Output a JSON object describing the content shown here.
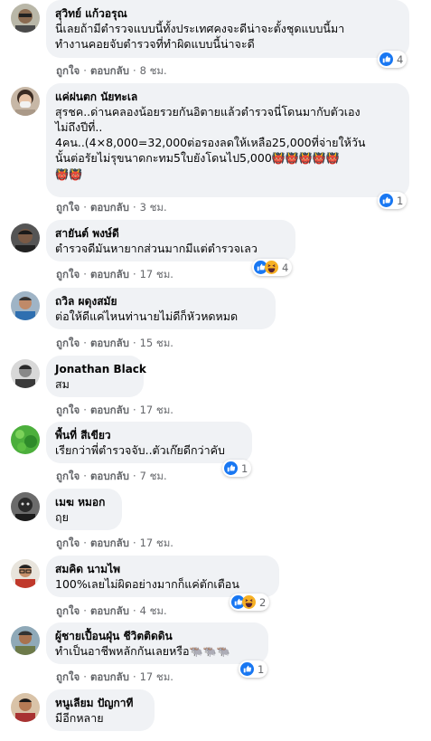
{
  "actions": {
    "like": "ถูกใจ",
    "reply": "ตอบกลับ",
    "sep": "·"
  },
  "colors": {
    "like_blue": "#1877f2",
    "haha_yellow": "#f7b125",
    "bubble": "#f0f2f5",
    "meta_gray": "#65676b"
  },
  "comments": [
    {
      "author": "สุวิทย์ แก้วอรุณ",
      "text": "นี่เลยถ้ามีตำรวจแบบนี้ทั้งประเทศคงจะดีน่าจะตั้งชุดแบบนี้มา\nทำงานคอยจับตำรวจที่ทำผิดแบบนี้น่าจะดี",
      "time": "8 ชม.",
      "reactions": [
        "like-icon"
      ],
      "reaction_count": "4",
      "avatar": "man-sunglasses-avatar"
    },
    {
      "author": "แค่ฝนตก นัยทะเล",
      "text": "สุรชค..ด่านคลองน้อยรวยกันอิตายแล้วตำรวจนี่โดนมากับตัวเอง\nไม่ถึงปีที่..\n4คน..(4×8,000=32,000ต่อรองลดให้เหลือ25,000ที่จ่ายให้วัน\nนั้นต่อรัยไม่รุขนาดกะทม5ใบยังโดนไป5,000",
      "emoji": "👹👹👹👹👹\n👹👹",
      "time": "3 ชม.",
      "reactions": [
        "like-icon"
      ],
      "reaction_count": "1",
      "avatar": "woman-mask-avatar"
    },
    {
      "author": "สายันต์ พงษ์ดี",
      "text": "ตำรวจดีมันหายากส่วนมากมีแต่ตำรวจเลว",
      "time": "17 ชม.",
      "reactions": [
        "like-icon",
        "haha-icon"
      ],
      "reaction_count": "4",
      "avatar": "man-dark-avatar"
    },
    {
      "author": "ถวิล ผดุงสมัย",
      "text": "ต่อให้ดีแค่ไหนท่านายไม่ดีก็หัวหดหมด",
      "time": "15 ชม.",
      "reactions": [],
      "reaction_count": "",
      "avatar": "man-blue-shirt-avatar"
    },
    {
      "author": "Jonathan Black",
      "text": "สม",
      "time": "17 ชม.",
      "reactions": [],
      "reaction_count": "",
      "avatar": "man-bw-avatar"
    },
    {
      "author": "พื้นที่ สีเขียว",
      "text": "เรียกว่าพี่ตำรวจจับ..ตัวเก๊ยดีกว่าคับ",
      "time": "7 ชม.",
      "reactions": [
        "like-icon"
      ],
      "reaction_count": "1",
      "avatar": "green-field-avatar"
    },
    {
      "author": "เมฆ หมอก",
      "text": "ฤย",
      "time": "17 ชม.",
      "reactions": [],
      "reaction_count": "",
      "avatar": "dark-figure-avatar"
    },
    {
      "author": "สมคิด นามไพ",
      "text": "100%เลยไม่ผิดอย่างมากก็แค่ตักเตือน",
      "time": "4 ชม.",
      "reactions": [
        "like-icon",
        "haha-icon"
      ],
      "reaction_count": "2",
      "avatar": "man-glasses-avatar"
    },
    {
      "author": "ผู้ชายเปื้อนฝุ่น ชีวิตติดดิน",
      "text": "ทำเป็นอาชีพหลักกันเลยหรือ",
      "emoji": "🐃🐃🐃",
      "time": "17 ชม.",
      "reactions": [
        "like-icon"
      ],
      "reaction_count": "1",
      "avatar": "man-outdoor-avatar"
    },
    {
      "author": "หนูเลียม ปัญกาที",
      "text": "มีอีกหลาย",
      "time": "",
      "reactions": [],
      "reaction_count": "",
      "avatar": "man-red-avatar"
    }
  ]
}
